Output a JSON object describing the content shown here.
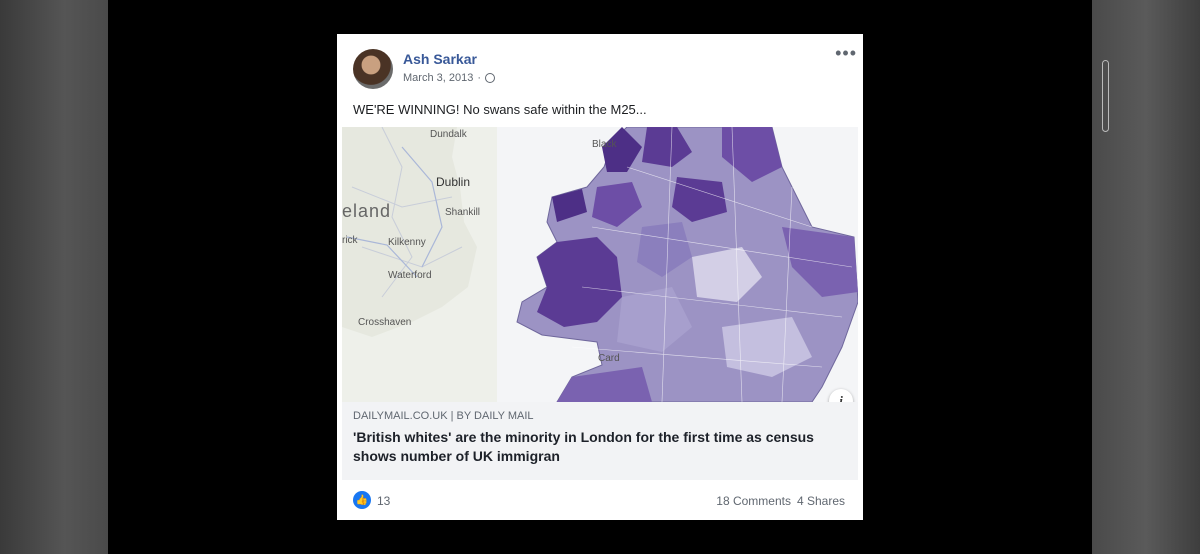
{
  "post": {
    "author": "Ash Sarkar",
    "date": "March 3, 2013",
    "separator": "·",
    "text": "WE'RE WINNING! No swans safe within the M25..."
  },
  "map_labels": {
    "dundalk": "Dundalk",
    "dublin": "Dublin",
    "ireland": "eland",
    "shankill": "Shankill",
    "kilkenny": "Kilkenny",
    "rick": "rick",
    "waterford": "Waterford",
    "crosshaven": "Crosshaven",
    "black": "Black",
    "cardiff": "Card"
  },
  "link": {
    "domain": "DAILYMAIL.CO.UK | BY DAILY MAIL",
    "headline": "'British whites' are the minority in London for the first time as census shows number of UK immigran"
  },
  "footer": {
    "likes": "13",
    "comments": "18 Comments",
    "shares": "4 Shares"
  },
  "colors": {
    "author": "#385898",
    "like_blue": "#1877f2",
    "map_dark": "#5b3b94",
    "map_light": "#b9b4d6"
  },
  "icons": {
    "globe": "globe-icon",
    "more": "more-icon",
    "like": "like-icon",
    "info": "info-icon"
  }
}
